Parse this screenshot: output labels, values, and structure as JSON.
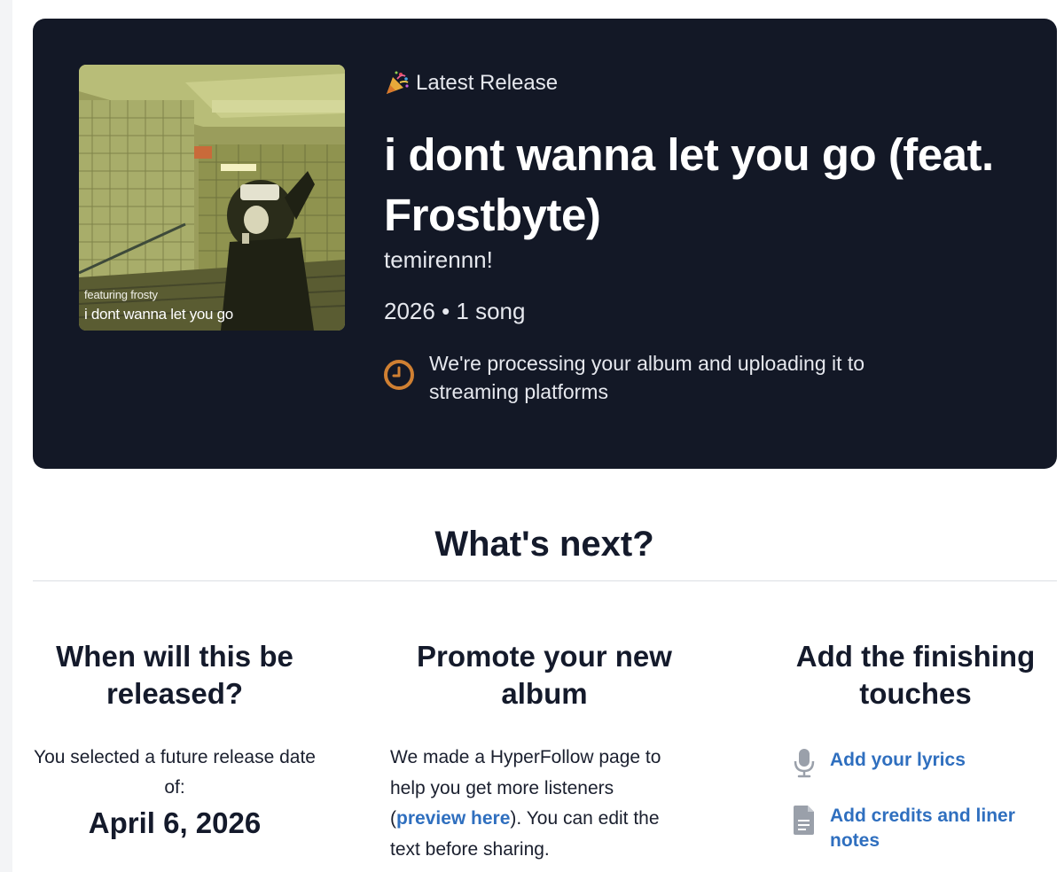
{
  "hero": {
    "release_tag": "Latest Release",
    "album_title": "i dont wanna let you go (feat. Frostbyte)",
    "artist": "temirennn!",
    "meta": "2026 • 1 song",
    "status": "We're processing your album and uploading it to streaming platforms",
    "cover": {
      "small_text": "featuring frosty",
      "big_text": "i dont wanna let you go"
    },
    "icons": {
      "tag_icon": "party-popper-icon",
      "status_icon": "clock-icon"
    },
    "colors": {
      "background": "#131826",
      "status_icon": "#d08032"
    }
  },
  "whats_next": {
    "heading": "What's next?"
  },
  "columns": {
    "release": {
      "heading": "When will this be released?",
      "text": "You selected a future release date of:",
      "date": "April 6, 2026"
    },
    "promote": {
      "heading": "Promote your new album",
      "text_before": "We made a HyperFollow page to help you get more listeners (",
      "link": "preview here",
      "text_after": "). You can edit the text before sharing."
    },
    "finishing": {
      "heading": "Add the finishing touches",
      "actions": [
        {
          "label": "Add your lyrics",
          "icon": "microphone-icon"
        },
        {
          "label": "Add credits and liner notes",
          "icon": "document-icon"
        }
      ]
    }
  },
  "colors": {
    "link": "#2f6fbf",
    "heading": "#141a2b"
  }
}
